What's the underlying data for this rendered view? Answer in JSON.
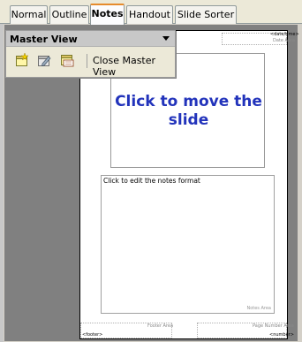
{
  "tabs": [
    {
      "label": "Normal",
      "active": false
    },
    {
      "label": "Outline",
      "active": false
    },
    {
      "label": "Notes",
      "active": true
    },
    {
      "label": "Handout",
      "active": false
    },
    {
      "label": "Slide Sorter",
      "active": false
    }
  ],
  "master_toolbar": {
    "title": "Master View",
    "icons": [
      "new-master-icon",
      "rename-master-icon",
      "delete-master-icon"
    ],
    "close_label": "Close Master View"
  },
  "page": {
    "header_tag": "<date/time>",
    "header_area": "Date Area",
    "slide_text": "Click to move the slide",
    "notes_text": "Click to edit the notes format",
    "notes_area": "Notes Area",
    "footer_area": "Footer Area",
    "page_number_area": "Page Number Area",
    "footer_tag": "<footer>",
    "number_tag": "<number>"
  },
  "colors": {
    "slide_text": "#2233bb",
    "active_tab_accent": "#e68b2c"
  }
}
